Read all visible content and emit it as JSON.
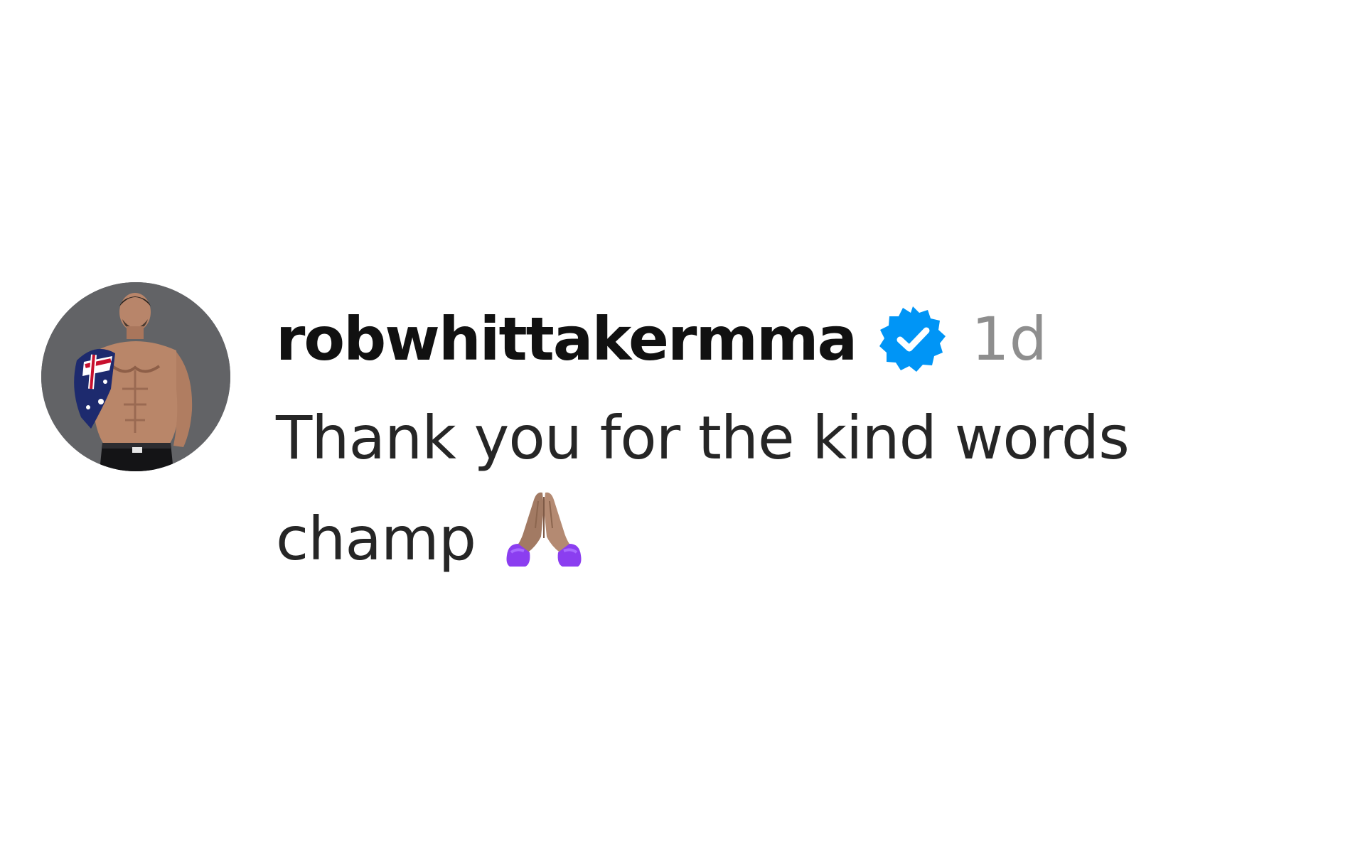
{
  "comment": {
    "username": "robwhittakermma",
    "verified_icon": "verified-badge-icon",
    "verified_color": "#0095f6",
    "timestamp": "1d",
    "text_line1": "Thank you for the kind words",
    "text_line2": "champ",
    "emoji": "folded-hands-emoji",
    "avatar": "profile-photo"
  }
}
